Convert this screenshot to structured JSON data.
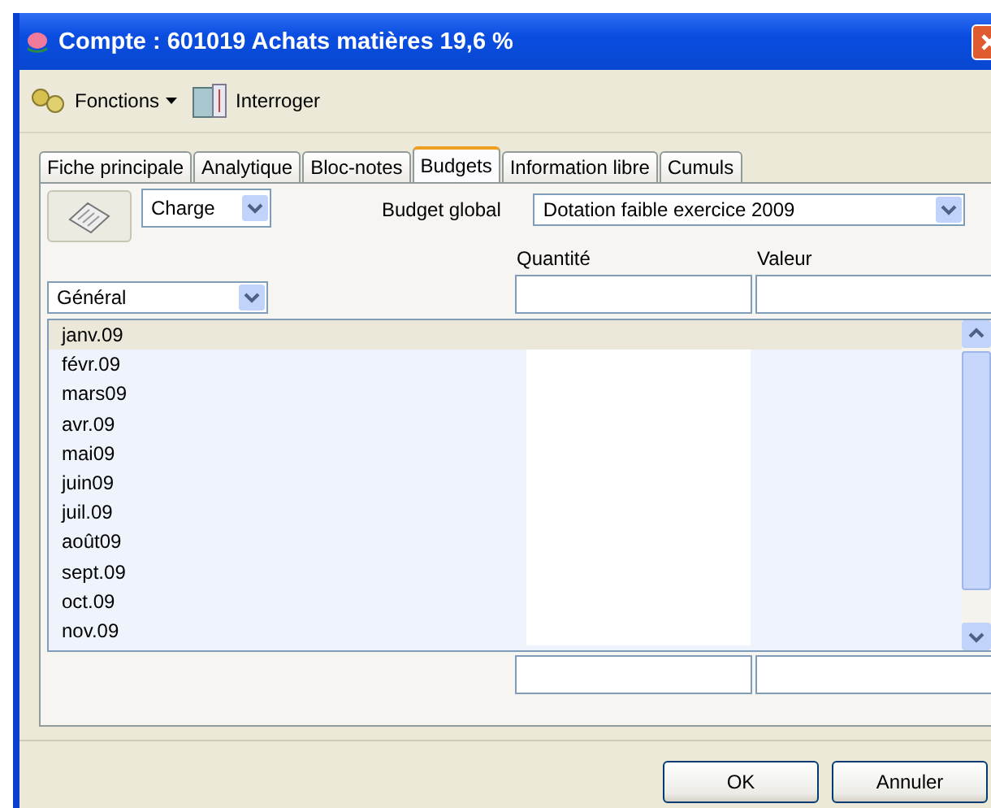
{
  "window": {
    "title": "Compte : 601019 Achats matières 19,6 %"
  },
  "toolbar": [
    {
      "label": "Fonctions",
      "kind": "menu"
    },
    {
      "label": "Interroger",
      "kind": "button"
    }
  ],
  "tabs": [
    {
      "label": "Fiche principale",
      "selected": false
    },
    {
      "label": "Analytique",
      "selected": false
    },
    {
      "label": "Bloc-notes",
      "selected": false
    },
    {
      "label": "Budgets",
      "selected": true
    },
    {
      "label": "Information libre",
      "selected": false
    },
    {
      "label": "Cumuls",
      "selected": false
    }
  ],
  "type_select": {
    "value": "Charge"
  },
  "budget_global": {
    "label": "Budget global",
    "value": "Dotation faible exercice 2009"
  },
  "columns": [
    "Quantité",
    "Valeur"
  ],
  "section_select": {
    "value": "Général"
  },
  "rows": [
    {
      "label": "janv.09",
      "selected": true
    },
    {
      "label": "févr.09",
      "selected": false
    },
    {
      "label": "mars09",
      "selected": false
    },
    {
      "label": "avr.09",
      "selected": false
    },
    {
      "label": "mai09",
      "selected": false
    },
    {
      "label": "juin09",
      "selected": false
    },
    {
      "label": "juil.09",
      "selected": false
    },
    {
      "label": "août09",
      "selected": false
    },
    {
      "label": "sept.09",
      "selected": false
    },
    {
      "label": "oct.09",
      "selected": false
    },
    {
      "label": "nov.09",
      "selected": false
    }
  ],
  "buttons": [
    "OK",
    "Annuler"
  ]
}
